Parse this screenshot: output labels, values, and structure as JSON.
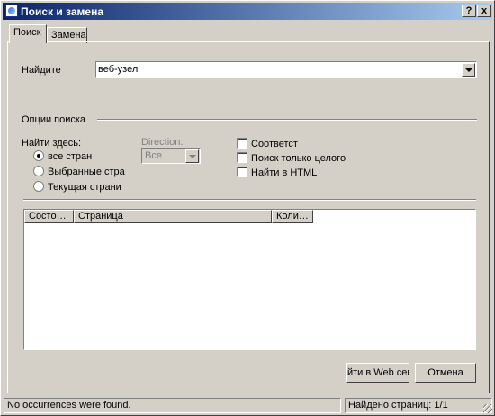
{
  "window": {
    "title": "Поиск и замена",
    "help_label": "?",
    "close_label": "x"
  },
  "tabs": [
    {
      "label": "Поиск"
    },
    {
      "label": "Замена"
    }
  ],
  "find": {
    "label": "Найдите",
    "value": "веб-узел"
  },
  "options": {
    "section_label": "Опции поиска",
    "find_in_label": "Найти здесь:",
    "radios": [
      {
        "label": "все стран",
        "selected": true
      },
      {
        "label": "Выбранные стра",
        "selected": false
      },
      {
        "label": "Текущая страни",
        "selected": false
      }
    ],
    "direction_label": "Direction:",
    "direction_value": "Все",
    "checkboxes": [
      {
        "label": "Соответст",
        "checked": false
      },
      {
        "label": "Поиск только целого",
        "checked": false
      },
      {
        "label": "Найти в HTML",
        "checked": false
      }
    ]
  },
  "results": {
    "columns": [
      "Состо…",
      "Страница",
      "Коли…"
    ]
  },
  "buttons": {
    "go_web": "йти в Web сеr",
    "cancel": "Отмена"
  },
  "status": {
    "left": "No occurrences were found.",
    "right": "Найдено страниц: 1/1"
  }
}
